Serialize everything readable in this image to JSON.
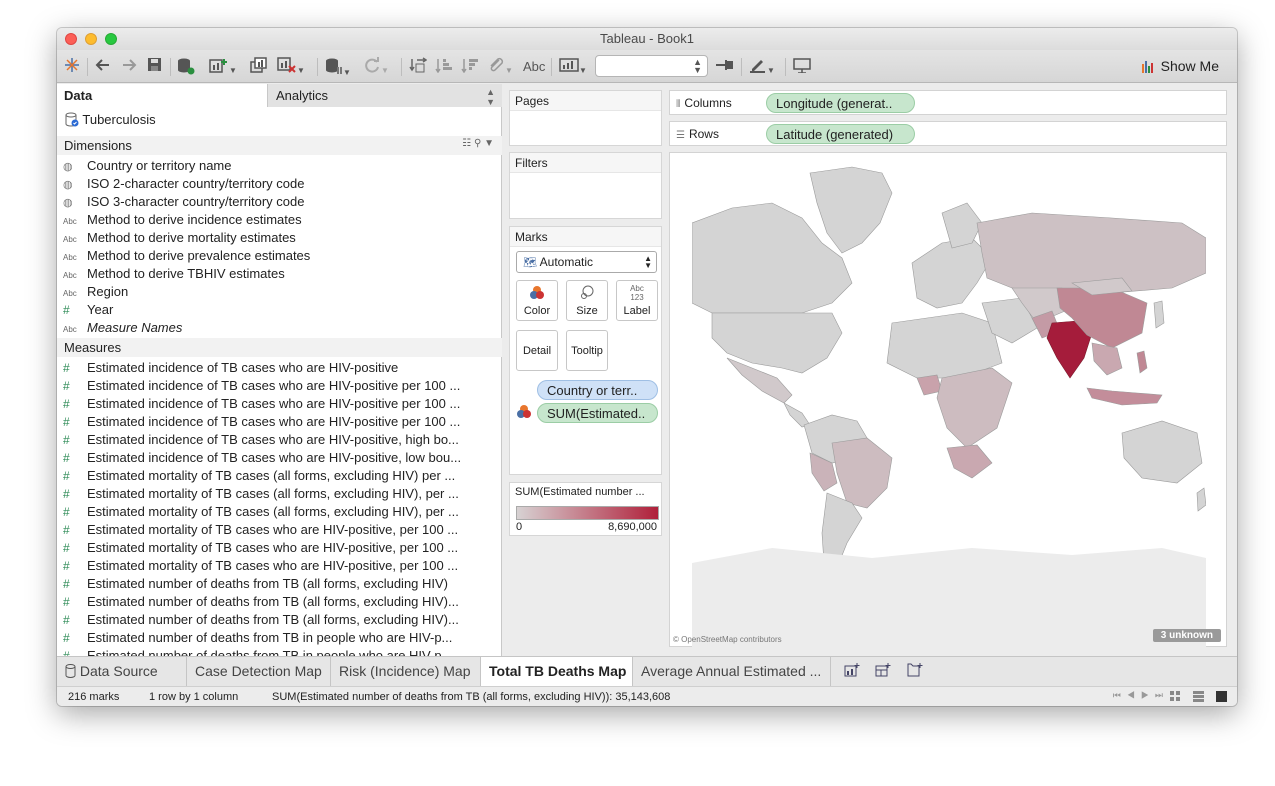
{
  "window": {
    "title": "Tableau - Book1"
  },
  "toolbar": {
    "text_button": "Abc",
    "show_me": "Show Me",
    "combo_value": ""
  },
  "left_pane": {
    "tab_data": "Data",
    "tab_analytics": "Analytics",
    "datasource": "Tuberculosis",
    "dimensions_header": "Dimensions",
    "dimensions": [
      {
        "icon": "globe-icon",
        "label": "Country or territory name"
      },
      {
        "icon": "globe-icon",
        "label": "ISO 2-character country/territory code"
      },
      {
        "icon": "globe-icon",
        "label": "ISO 3-character country/territory code"
      },
      {
        "icon": "abc-icon",
        "label": "Method to derive incidence estimates"
      },
      {
        "icon": "abc-icon",
        "label": "Method to derive mortality estimates"
      },
      {
        "icon": "abc-icon",
        "label": "Method to derive prevalence estimates"
      },
      {
        "icon": "abc-icon",
        "label": "Method to derive TBHIV estimates"
      },
      {
        "icon": "abc-icon",
        "label": "Region"
      },
      {
        "icon": "hash-icon",
        "label": "Year"
      },
      {
        "icon": "abc-icon",
        "label": "Measure Names"
      }
    ],
    "measures_header": "Measures",
    "measures": [
      "Estimated incidence of TB cases who are HIV-positive",
      "Estimated incidence of TB cases who are HIV-positive per 100 ...",
      "Estimated incidence of TB cases who are HIV-positive per 100 ...",
      "Estimated incidence of TB cases who are HIV-positive per 100 ...",
      "Estimated incidence of TB cases who are HIV-positive, high bo...",
      "Estimated incidence of TB cases who are HIV-positive, low bou...",
      "Estimated mortality of TB cases (all forms, excluding HIV) per ...",
      "Estimated mortality of TB cases (all forms, excluding HIV), per ...",
      "Estimated mortality of TB cases (all forms, excluding HIV), per ...",
      "Estimated mortality of TB cases who are HIV-positive, per 100 ...",
      "Estimated mortality of TB cases who are HIV-positive, per 100 ...",
      "Estimated mortality of TB cases who are HIV-positive, per 100 ...",
      "Estimated number of deaths from TB (all forms, excluding HIV)",
      "Estimated number of deaths from TB (all forms, excluding HIV)...",
      "Estimated number of deaths from TB (all forms, excluding HIV)...",
      "Estimated number of deaths from TB in people who are HIV-p...",
      "Estimated number of deaths from TB in people who are HIV-p..."
    ]
  },
  "cards": {
    "pages": "Pages",
    "filters": "Filters",
    "marks": "Marks",
    "marks_type": "Automatic",
    "color": "Color",
    "size": "Size",
    "label": "Label",
    "label_glyph_top": "Abc",
    "label_glyph_bottom": "123",
    "detail": "Detail",
    "tooltip": "Tooltip",
    "pill_detail": "Country or terr..",
    "pill_color": "SUM(Estimated..",
    "legend_title": "SUM(Estimated number ...",
    "legend_min": "0",
    "legend_max": "8,690,000"
  },
  "shelves": {
    "columns_label": "Columns",
    "columns_pill": "Longitude (generat..",
    "rows_label": "Rows",
    "rows_pill": "Latitude (generated)"
  },
  "viz": {
    "attribution": "© OpenStreetMap contributors",
    "unknown": "3 unknown",
    "colors": {
      "base": "#d4d4d4",
      "light": "#cdbcc0",
      "mid": "#c9a2ab",
      "strong": "#b87f8d",
      "max": "#a51c3b"
    }
  },
  "sheet_tabs": {
    "data_source": "Data Source",
    "tabs": [
      "Case Detection Map",
      "Risk (Incidence) Map",
      "Total TB Deaths Map",
      "Average Annual Estimated ..."
    ]
  },
  "status": {
    "marks": "216 marks",
    "dims": "1 row by 1 column",
    "sum": "SUM(Estimated number of deaths from TB (all forms, excluding HIV)): 35,143,608"
  }
}
